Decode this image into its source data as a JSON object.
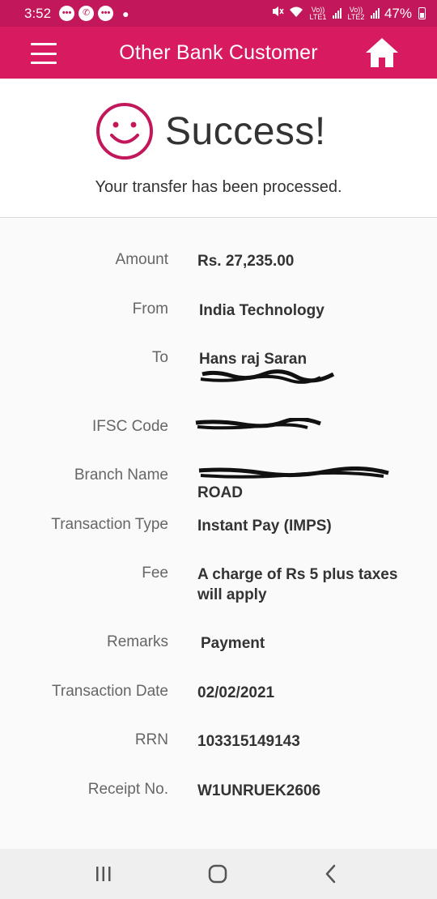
{
  "status_bar": {
    "time": "3:52",
    "notification_icons": [
      "chat-icon",
      "whatsapp-icon",
      "chat-icon"
    ],
    "sim1": "Vo)) LTE1",
    "sim2": "Vo)) LTE2",
    "battery": "47%"
  },
  "app_bar": {
    "title": "Other Bank Customer"
  },
  "success": {
    "title": "Success!",
    "subtitle": "Your transfer has been processed."
  },
  "details": {
    "amount": {
      "label": "Amount",
      "value": "Rs. 27,235.00"
    },
    "from": {
      "label": "From",
      "value": "India Technology"
    },
    "to": {
      "label": "To",
      "value": "Hans raj Saran"
    },
    "ifsc": {
      "label": "IFSC Code"
    },
    "branch": {
      "label": "Branch Name",
      "value_tail": "ROAD"
    },
    "transaction_type": {
      "label": "Transaction Type",
      "value": "Instant Pay (IMPS)"
    },
    "fee": {
      "label": "Fee",
      "value": "A charge of Rs 5 plus taxes will apply"
    },
    "remarks": {
      "label": "Remarks",
      "value": "Payment"
    },
    "transaction_date": {
      "label": "Transaction Date",
      "value": "02/02/2021"
    },
    "rrn": {
      "label": "RRN",
      "value": "103315149143"
    },
    "receipt": {
      "label": "Receipt No.",
      "value": "W1UNRUEK2606"
    }
  },
  "colors": {
    "status_bar": "#c2185b",
    "app_bar": "#d81b60",
    "accent": "#c2185b",
    "nav_bar": "#efefef"
  },
  "nav_bar": {
    "icons": [
      "recent-apps-icon",
      "home-circle-icon",
      "back-icon"
    ]
  }
}
